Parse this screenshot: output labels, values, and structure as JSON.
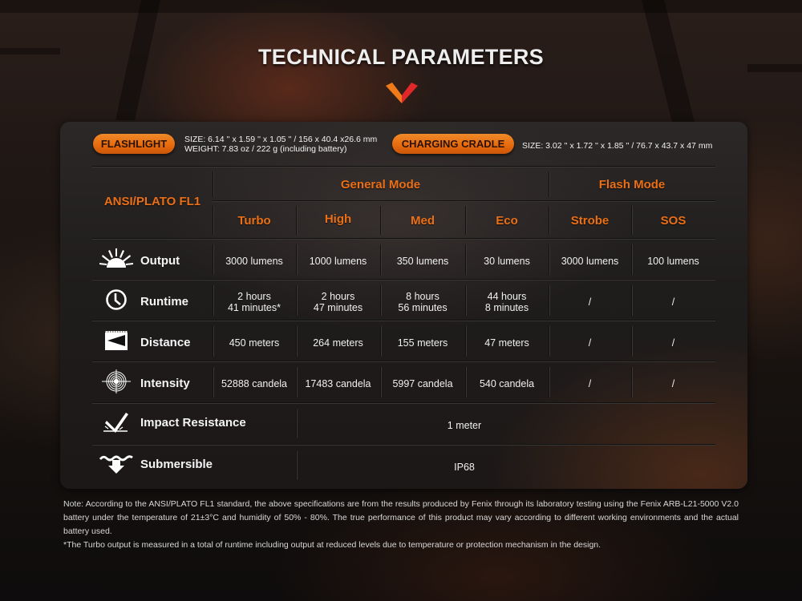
{
  "header": {
    "title": "TECHNICAL PARAMETERS",
    "chevron_colors": [
      "#f07a1a",
      "#e0282a"
    ]
  },
  "products": {
    "flashlight": {
      "label": "FLASHLIGHT",
      "size": "SIZE: 6.14 '' x 1.59 '' x 1.05 '' / 156 x 40.4 x26.6 mm",
      "weight": "WEIGHT: 7.83 oz / 222 g (including battery)"
    },
    "cradle": {
      "label": "CHARGING CRADLE",
      "size": "SIZE: 3.02 '' x 1.72 '' x 1.85 '' / 76.7 x 43.7 x 47 mm"
    }
  },
  "table": {
    "standard": "ANSI/PLATO FL1",
    "groups": [
      "General Mode",
      "Flash Mode"
    ],
    "modes": [
      "Turbo",
      "High",
      "Med",
      "Eco",
      "Strobe",
      "SOS"
    ],
    "rows": [
      {
        "icon": "sun-rays-icon",
        "label": "Output",
        "values": [
          [
            "3000 lumens"
          ],
          [
            "1000 lumens"
          ],
          [
            "350 lumens"
          ],
          [
            "30 lumens"
          ],
          [
            "3000 lumens"
          ],
          [
            "100 lumens"
          ]
        ]
      },
      {
        "icon": "clock-icon",
        "label": "Runtime",
        "values": [
          [
            "2 hours",
            "41 minutes*"
          ],
          [
            "2 hours",
            "47 minutes"
          ],
          [
            "8 hours",
            "56 minutes"
          ],
          [
            "44 hours",
            "8 minutes"
          ],
          [
            "/"
          ],
          [
            "/"
          ]
        ]
      },
      {
        "icon": "beam-distance-icon",
        "label": "Distance",
        "values": [
          [
            "450 meters"
          ],
          [
            "264 meters"
          ],
          [
            "155 meters"
          ],
          [
            "47 meters"
          ],
          [
            "/"
          ],
          [
            "/"
          ]
        ]
      },
      {
        "icon": "target-icon",
        "label": "Intensity",
        "values": [
          [
            "52888 candela"
          ],
          [
            "17483 candela"
          ],
          [
            "5997 candela"
          ],
          [
            "540 candela"
          ],
          [
            "/"
          ],
          [
            "/"
          ]
        ]
      }
    ],
    "span_rows": [
      {
        "icon": "impact-check-icon",
        "label": "Impact Resistance",
        "value": "1 meter"
      },
      {
        "icon": "submersible-icon",
        "label": "Submersible",
        "value": "IP68"
      }
    ]
  },
  "notes": {
    "note": "Note: According to the ANSI/PLATO FL1 standard, the above specifications are from the results produced by Fenix through its laboratory testing using the Fenix ARB-L21-5000 V2.0 battery under the temperature of 21±3°C and humidity of 50% - 80%. The true performance of this product may vary according to different working environments and the actual battery used.",
    "footnote": "*The Turbo output is measured in a total of runtime including output at reduced levels due to temperature or protection mechanism in the design."
  }
}
